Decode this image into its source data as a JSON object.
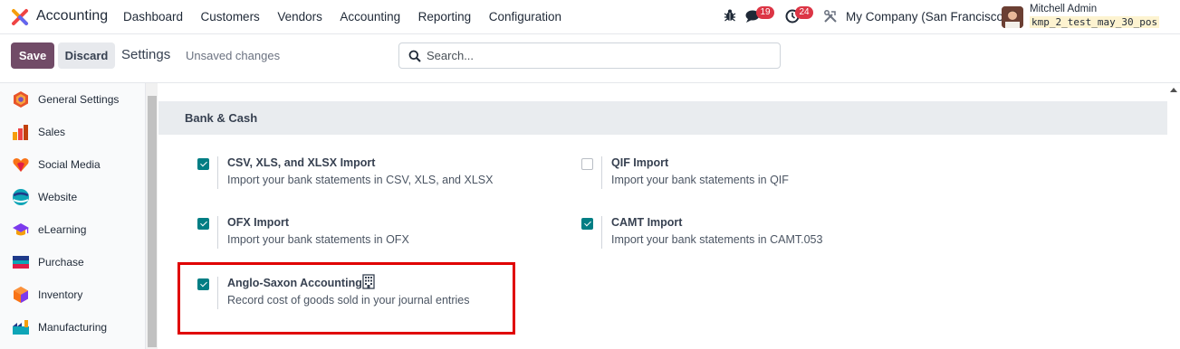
{
  "app": {
    "name": "Accounting"
  },
  "menu": [
    "Dashboard",
    "Customers",
    "Vendors",
    "Accounting",
    "Reporting",
    "Configuration"
  ],
  "systray": {
    "messages_count": "19",
    "activities_count": "24",
    "company": "My Company (San Francisco)",
    "user_name": "Mitchell Admin",
    "database": "kmp_2_test_may_30_pos"
  },
  "control": {
    "save_label": "Save",
    "discard_label": "Discard",
    "title": "Settings",
    "status": "Unsaved changes",
    "search_placeholder": "Search..."
  },
  "sidebar": {
    "items": [
      {
        "label": "General Settings",
        "icon": "general-settings-icon"
      },
      {
        "label": "Sales",
        "icon": "sales-icon"
      },
      {
        "label": "Social Media",
        "icon": "social-media-icon"
      },
      {
        "label": "Website",
        "icon": "website-icon"
      },
      {
        "label": "eLearning",
        "icon": "elearning-icon"
      },
      {
        "label": "Purchase",
        "icon": "purchase-icon"
      },
      {
        "label": "Inventory",
        "icon": "inventory-icon"
      },
      {
        "label": "Manufacturing",
        "icon": "manufacturing-icon"
      }
    ]
  },
  "section": {
    "title": "Bank & Cash",
    "settings": [
      {
        "title": "CSV, XLS, and XLSX Import",
        "description": "Import your bank statements in CSV, XLS, and XLSX",
        "checked": true
      },
      {
        "title": "QIF Import",
        "description": "Import your bank statements in QIF",
        "checked": false
      },
      {
        "title": "OFX Import",
        "description": "Import your bank statements in OFX",
        "checked": true
      },
      {
        "title": "CAMT Import",
        "description": "Import your bank statements in CAMT.053",
        "checked": true
      },
      {
        "title": "Anglo-Saxon Accounting",
        "description": "Record cost of goods sold in your journal entries",
        "checked": true,
        "icon": "building-icon"
      }
    ]
  },
  "colors": {
    "primary": "#714b67",
    "checkbox": "#017e84",
    "highlight": "#e00000",
    "badge": "#dc3545"
  }
}
